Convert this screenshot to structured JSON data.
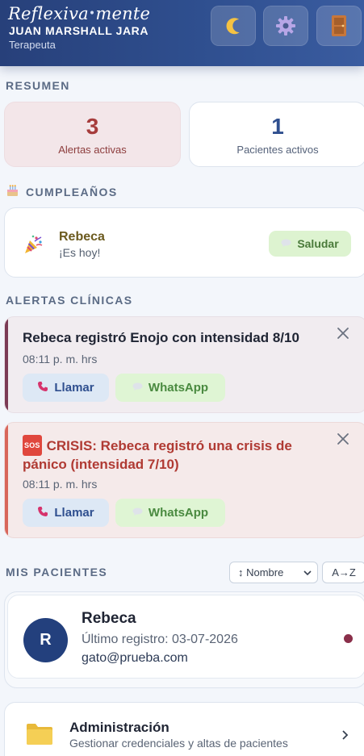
{
  "header": {
    "brand_left": "Reflexiva",
    "brand_dot": "•",
    "brand_right": "mente",
    "user_name": "JUAN MARSHALL JARA",
    "user_role": "Terapeuta",
    "buttons": [
      {
        "icon": "moon-icon"
      },
      {
        "icon": "gear-icon"
      },
      {
        "icon": "door-icon"
      }
    ]
  },
  "summary": {
    "title": "RESUMEN",
    "alerts_count": "3",
    "alerts_label": "Alertas activas",
    "patients_count": "1",
    "patients_label": "Pacientes activos"
  },
  "birthdays": {
    "title": "CUMPLEAÑOS",
    "name": "Rebeca",
    "subtitle": "¡Es hoy!",
    "greet_label": "Saludar"
  },
  "alerts": {
    "title": "ALERTAS CLÍNICAS",
    "items": [
      {
        "message": "Rebeca registró Enojo con intensidad 8/10",
        "time": "08:11 p. m. hrs",
        "call_label": "Llamar",
        "whatsapp_label": "WhatsApp"
      },
      {
        "badge": "SOS",
        "message": "CRISIS: Rebeca registró una crisis de pánico (intensidad 7/10)",
        "time": "08:11 p. m. hrs",
        "call_label": "Llamar",
        "whatsapp_label": "WhatsApp"
      }
    ]
  },
  "patients": {
    "title": "MIS PACIENTES",
    "sort_select": "↕ Nombre",
    "sort_order": "A→Z",
    "items": [
      {
        "initial": "R",
        "name": "Rebeca",
        "last_record": "Último registro: 03-07-2026",
        "email": "gato@prueba.com"
      }
    ]
  },
  "admin": {
    "title": "Administración",
    "subtitle": "Gestionar credenciales y altas de pacientes"
  },
  "colors": {
    "header": "#2f4f8f",
    "alert_accent": "#7b3b55",
    "crisis_accent": "#d8675c",
    "call_bg": "#dde8f5",
    "whatsapp_bg": "#dff5d4"
  }
}
